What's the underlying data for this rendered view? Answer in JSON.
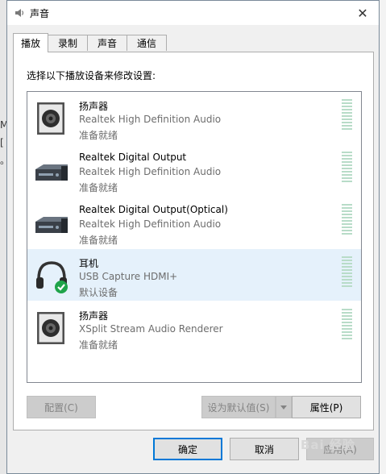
{
  "dialog": {
    "title": "声音",
    "icon": "speaker-icon",
    "close": "✕"
  },
  "tabs": [
    {
      "label": "播放",
      "active": true
    },
    {
      "label": "录制",
      "active": false
    },
    {
      "label": "声音",
      "active": false
    },
    {
      "label": "通信",
      "active": false
    }
  ],
  "panel": {
    "instruction": "选择以下播放设备来修改设置:"
  },
  "devices": [
    {
      "name": "扬声器",
      "description": "Realtek High Definition Audio",
      "status": "准备就绪",
      "icon": "speaker-box-icon",
      "selected": false
    },
    {
      "name": "Realtek Digital Output",
      "description": "Realtek High Definition Audio",
      "status": "准备就绪",
      "icon": "receiver-icon",
      "selected": false
    },
    {
      "name": "Realtek Digital Output(Optical)",
      "description": "Realtek High Definition Audio",
      "status": "准备就绪",
      "icon": "receiver-icon",
      "selected": false
    },
    {
      "name": "耳机",
      "description": "USB Capture HDMI+",
      "status": "默认设备",
      "icon": "headphones-icon",
      "selected": true,
      "default": true
    },
    {
      "name": "扬声器",
      "description": "XSplit  Stream  Audio  Renderer",
      "status": "准备就绪",
      "icon": "speaker-box-icon",
      "selected": false
    }
  ],
  "buttons": {
    "configure": "配置(C)",
    "set_default": "设为默认值(S)",
    "properties": "属性(P)",
    "ok": "确定",
    "cancel": "取消",
    "apply": "应用(A)"
  },
  "background": {
    "glyphs": [
      "M",
      "[",
      "。"
    ]
  },
  "colors": {
    "selection": "#e5f1fb",
    "meter": "#b8dcc8",
    "default_check": "#1fa34a",
    "focus_border": "#0078d7"
  },
  "watermark": "Bai 经验"
}
